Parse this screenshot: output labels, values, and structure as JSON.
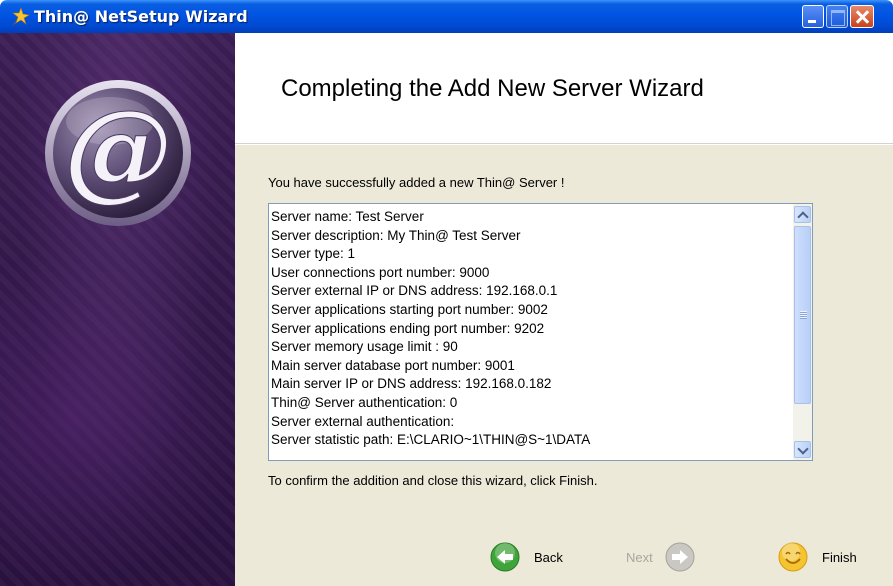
{
  "window": {
    "title": "Thin@ NetSetup Wizard",
    "app_icon": "wizard-icon"
  },
  "header": {
    "title": "Completing the Add New Server Wizard"
  },
  "side_panel": {
    "logo": "at-sign-logo",
    "logo_text": "@"
  },
  "body": {
    "success_message": "You have successfully added a new Thin@ Server !",
    "summary_lines": [
      "Server name: Test Server",
      "Server description: My Thin@ Test Server",
      "Server type: 1",
      "User connections port number: 9000",
      "Server external IP or DNS address: 192.168.0.1",
      "Server applications starting port number: 9002",
      "Server applications ending port number: 9202",
      "Server memory usage limit : 90",
      "Main server database port number: 9001",
      "Main server IP or DNS address: 192.168.0.182",
      "Thin@ Server authentication: 0",
      "Server external authentication:",
      "Server statistic path: E:\\CLARIO~1\\THIN@S~1\\DATA"
    ],
    "confirm_message": "To confirm the addition and close this wizard, click Finish."
  },
  "buttons": {
    "back": {
      "label": "Back",
      "icon": "back-arrow-icon",
      "enabled": true
    },
    "next": {
      "label": "Next",
      "icon": "next-arrow-icon",
      "enabled": false
    },
    "finish": {
      "label": "Finish",
      "icon": "smiley-icon",
      "enabled": true
    }
  },
  "colors": {
    "titlebar": "#0054e3",
    "panel": "#ece9d8",
    "back_icon": "#3fa43a",
    "finish_icon": "#f5c431",
    "side_panel": "#3c1e55"
  }
}
